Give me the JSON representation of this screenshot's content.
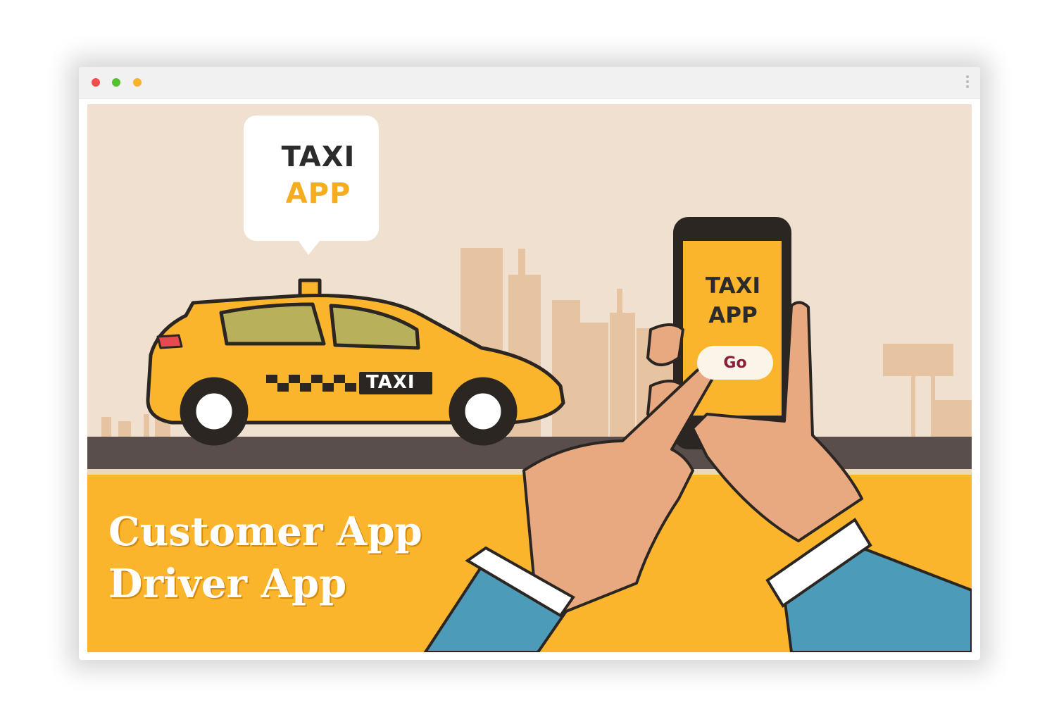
{
  "window": {
    "controls": [
      "close",
      "minimize",
      "maximize"
    ],
    "colors": {
      "close": "#f24b4b",
      "minimize": "#55c12e",
      "maximize": "#f7b32b"
    },
    "menu_icon": "vertical-ellipsis-icon"
  },
  "hero": {
    "bubble": {
      "line1": "TAXI",
      "line2": "APP"
    },
    "car_label": "TAXI",
    "phone": {
      "line1": "TAXI",
      "line2": "APP",
      "button": "Go"
    },
    "captions": [
      "Customer App",
      "Driver App"
    ],
    "colors": {
      "sky": "#f0e0d0",
      "buildings": "#e6c4a2",
      "road": "#5a4e4c",
      "ground": "#fbb52c",
      "taxi": "#fbb52c",
      "sleeve": "#4c9bb8",
      "skin": "#e8a880"
    }
  }
}
